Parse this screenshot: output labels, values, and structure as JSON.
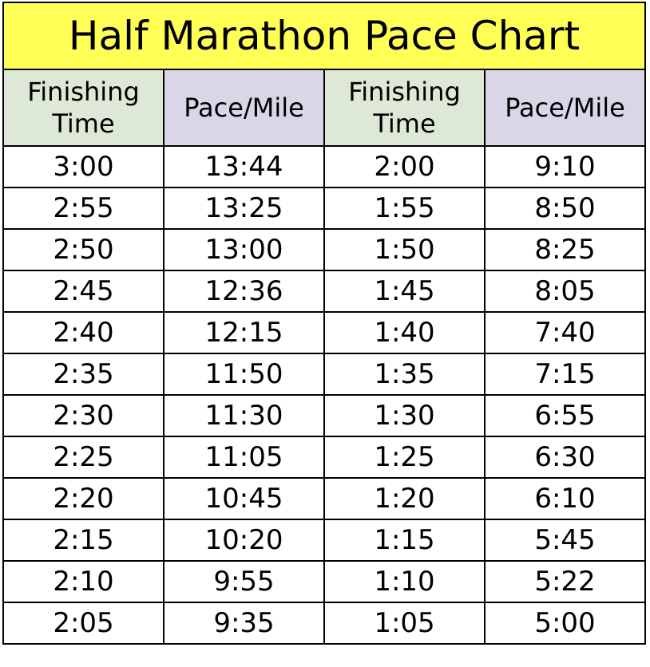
{
  "title": "Half Marathon Pace Chart",
  "headers": [
    {
      "line1": "Finishing",
      "line2": "Time"
    },
    {
      "label": "Pace/Mile"
    },
    {
      "line1": "Finishing",
      "line2": "Time"
    },
    {
      "label": "Pace/Mile"
    }
  ],
  "colors": {
    "title_bg": "#ffff55",
    "time_header_bg": "#dde8d6",
    "pace_header_bg": "#dad6e8"
  },
  "rows": [
    {
      "time1": "3:00",
      "pace1": "13:44",
      "time2": "2:00",
      "pace2": "9:10"
    },
    {
      "time1": "2:55",
      "pace1": "13:25",
      "time2": "1:55",
      "pace2": "8:50"
    },
    {
      "time1": "2:50",
      "pace1": "13:00",
      "time2": "1:50",
      "pace2": "8:25"
    },
    {
      "time1": "2:45",
      "pace1": "12:36",
      "time2": "1:45",
      "pace2": "8:05"
    },
    {
      "time1": "2:40",
      "pace1": "12:15",
      "time2": "1:40",
      "pace2": "7:40"
    },
    {
      "time1": "2:35",
      "pace1": "11:50",
      "time2": "1:35",
      "pace2": "7:15"
    },
    {
      "time1": "2:30",
      "pace1": "11:30",
      "time2": "1:30",
      "pace2": "6:55"
    },
    {
      "time1": "2:25",
      "pace1": "11:05",
      "time2": "1:25",
      "pace2": "6:30"
    },
    {
      "time1": "2:20",
      "pace1": "10:45",
      "time2": "1:20",
      "pace2": "6:10"
    },
    {
      "time1": "2:15",
      "pace1": "10:20",
      "time2": "1:15",
      "pace2": "5:45"
    },
    {
      "time1": "2:10",
      "pace1": "9:55",
      "time2": "1:10",
      "pace2": "5:22"
    },
    {
      "time1": "2:05",
      "pace1": "9:35",
      "time2": "1:05",
      "pace2": "5:00"
    }
  ]
}
